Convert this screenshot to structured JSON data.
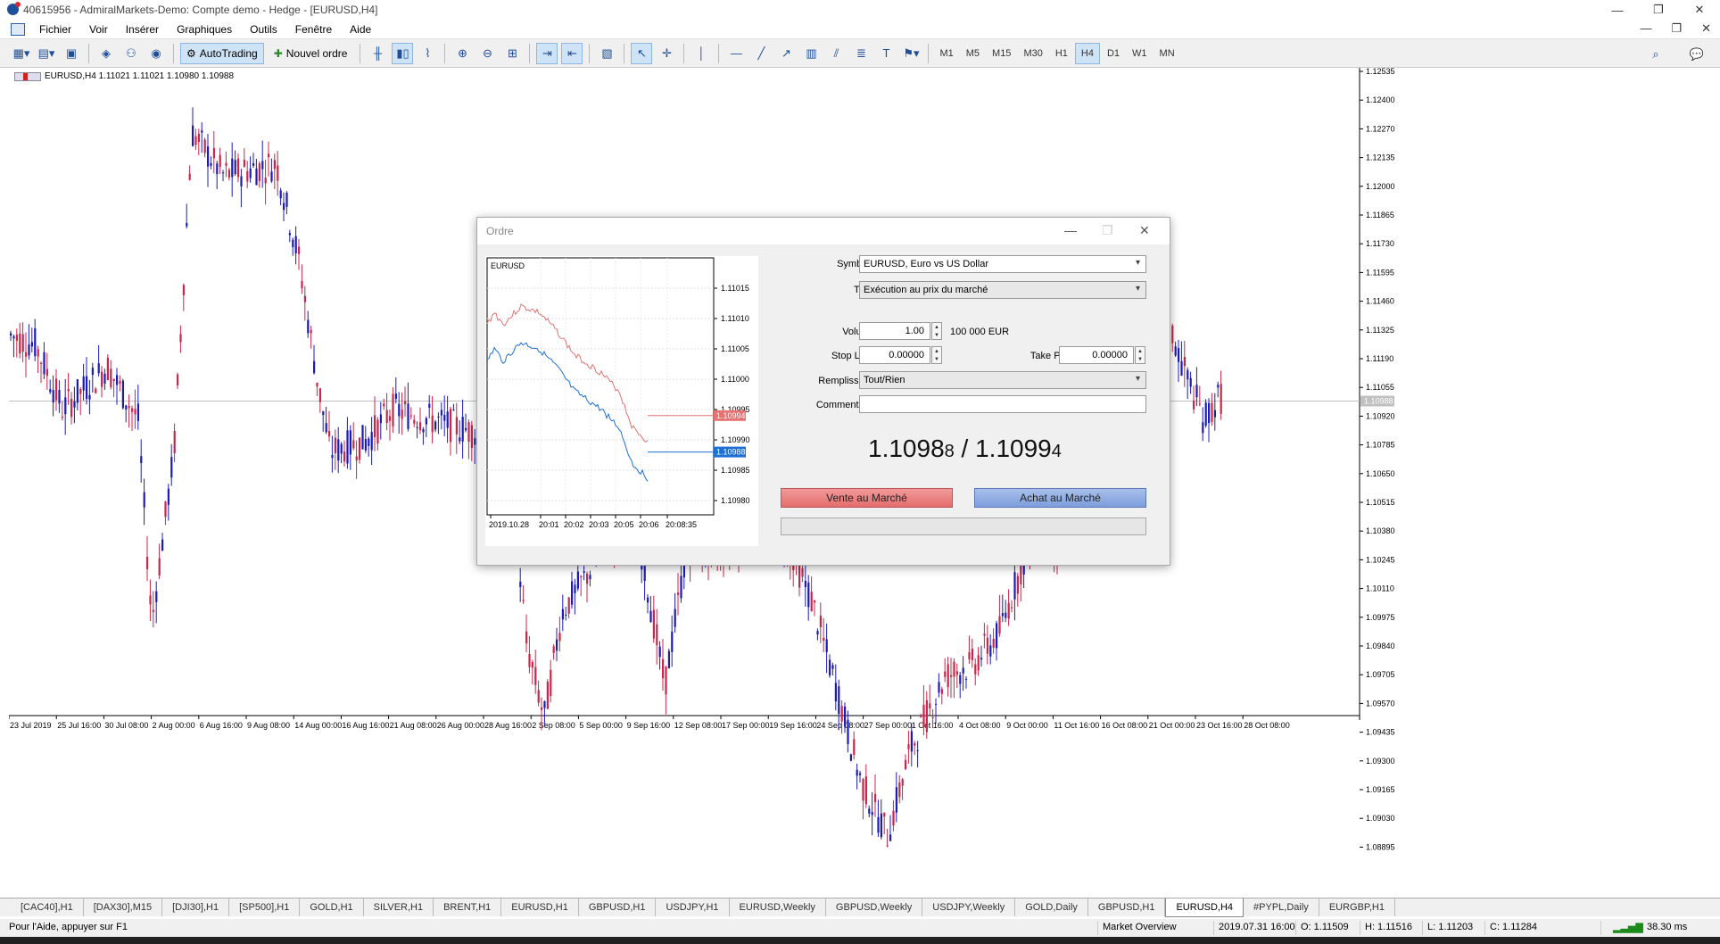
{
  "window": {
    "title": "40615956 - AdmiralMarkets-Demo: Compte demo - Hedge - [EURUSD,H4]",
    "controls": [
      "—",
      "❐",
      "✕"
    ],
    "mdi_controls": [
      "—",
      "❐",
      "✕"
    ]
  },
  "menu": [
    "Fichier",
    "Voir",
    "Insérer",
    "Graphiques",
    "Outils",
    "Fenêtre",
    "Aide"
  ],
  "toolbar": {
    "autotrading": "AutoTrading",
    "new_order": "Nouvel ordre",
    "timeframes": [
      "M1",
      "M5",
      "M15",
      "M30",
      "H1",
      "H4",
      "D1",
      "W1",
      "MN"
    ],
    "active_timeframe": "H4"
  },
  "chart": {
    "info": "EURUSD,H4  1.11021 1.11021 1.10980 1.10988",
    "current_price": "1.10988",
    "price_labels": [
      "1.12535",
      "1.12400",
      "1.12270",
      "1.12135",
      "1.12000",
      "1.11865",
      "1.11730",
      "1.11595",
      "1.11460",
      "1.11325",
      "1.11190",
      "1.11055",
      "1.10920",
      "1.10785",
      "1.10650",
      "1.10515",
      "1.10380",
      "1.10245",
      "1.10110",
      "1.09975",
      "1.09840",
      "1.09705",
      "1.09570",
      "1.09435",
      "1.09300",
      "1.09165",
      "1.09030",
      "1.08895"
    ],
    "time_labels": [
      "23 Jul 2019",
      "25 Jul 16:00",
      "30 Jul 08:00",
      "2 Aug 00:00",
      "6 Aug 16:00",
      "9 Aug 08:00",
      "14 Aug 00:00",
      "16 Aug 16:00",
      "21 Aug 08:00",
      "26 Aug 00:00",
      "28 Aug 16:00",
      "2 Sep 08:00",
      "5 Sep 00:00",
      "9 Sep 16:00",
      "12 Sep 08:00",
      "17 Sep 00:00",
      "19 Sep 16:00",
      "24 Sep 08:00",
      "27 Sep 00:00",
      "1 Oct 16:00",
      "4 Oct 08:00",
      "9 Oct 00:00",
      "11 Oct 16:00",
      "16 Oct 08:00",
      "21 Oct 00:00",
      "23 Oct 16:00",
      "28 Oct 08:00"
    ],
    "colors": {
      "bull": "#1c1cb4",
      "bear": "#c8264a"
    }
  },
  "tabs": [
    "[CAC40],H1",
    "[DAX30],M15",
    "[DJI30],H1",
    "[SP500],H1",
    "GOLD,H1",
    "SILVER,H1",
    "BRENT,H1",
    "EURUSD,H1",
    "GBPUSD,H1",
    "USDJPY,H1",
    "EURUSD,Weekly",
    "GBPUSD,Weekly",
    "USDJPY,Weekly",
    "GOLD,Daily",
    "GBPUSD,H1",
    "EURUSD,H4",
    "#PYPL,Daily",
    "EURGBP,H1"
  ],
  "active_tab": "EURUSD,H4",
  "status": {
    "help": "Pour l'Aide, appuyer sur F1",
    "profile": "Market Overview",
    "time": "2019.07.31 16:00",
    "open": "O: 1.11509",
    "high": "H: 1.11516",
    "low": "L: 1.11203",
    "close": "C: 1.11284",
    "ping": "38.30 ms"
  },
  "dialog": {
    "title": "Ordre",
    "mini_chart": {
      "symbol": "EURUSD",
      "ask_label": "1.10994",
      "bid_label": "1.10988",
      "price_labels": [
        "1.11015",
        "1.11010",
        "1.11005",
        "1.11000",
        "1.10995",
        "1.10990",
        "1.10985",
        "1.10980"
      ],
      "time_labels": [
        "2019.10.28",
        "20:01",
        "20:02",
        "20:03",
        "20:05",
        "20:06",
        "20:08:35"
      ]
    },
    "symbol_label": "Symbole :",
    "symbol_value": "EURUSD, Euro vs US Dollar",
    "type_label": "Type :",
    "type_value": "Exécution au prix du marché",
    "volume_label": "Volume :",
    "volume_value": "1.00",
    "volume_note": "100 000 EUR",
    "sl_label": "Stop Loss :",
    "sl_value": "0.00000",
    "tp_label": "Take Profit :",
    "tp_value": "0.00000",
    "fill_label": "Remplissage :",
    "fill_value": "Tout/Rien",
    "comment_label": "Commentaire :",
    "comment_value": "",
    "bid_main": "1.1098",
    "bid_small": "8",
    "ask_main": "1.1099",
    "ask_small": "4",
    "price_sep": " / ",
    "sell_button": "Vente au Marché",
    "buy_button": "Achat au Marché"
  }
}
